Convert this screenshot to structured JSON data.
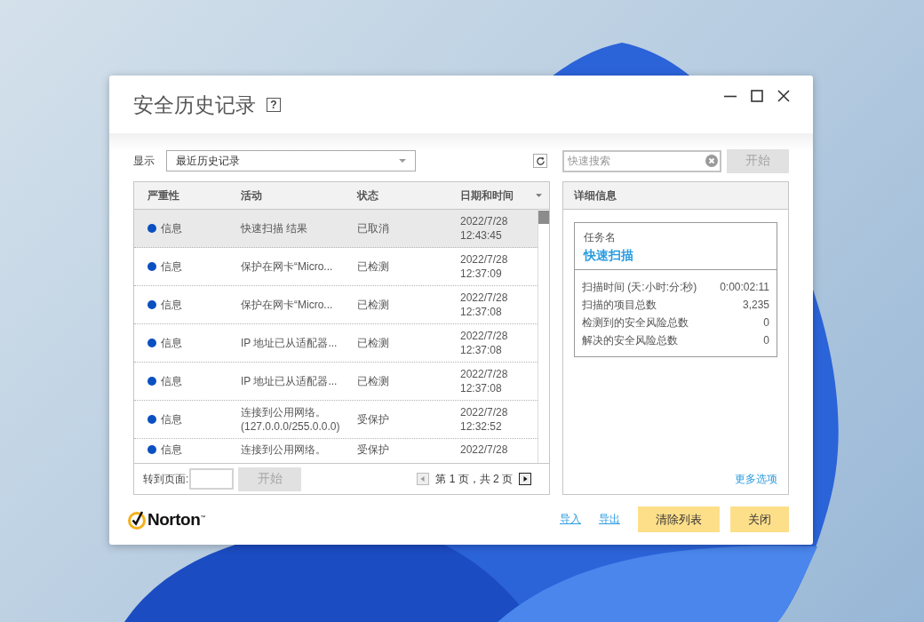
{
  "window": {
    "title": "安全历史记录",
    "help": "?"
  },
  "filter": {
    "label": "显示",
    "value": "最近历史记录"
  },
  "search": {
    "placeholder": "快速搜索",
    "button": {
      "label": "开始",
      "disabled": true
    }
  },
  "table": {
    "columns": [
      {
        "label": "严重性",
        "sorted": false
      },
      {
        "label": "活动",
        "sorted": false
      },
      {
        "label": "状态",
        "sorted": false
      },
      {
        "label": "日期和时间",
        "sorted": true
      }
    ],
    "rows": [
      {
        "severity": "信息",
        "color": "#0b50c0",
        "activity": [
          "快速扫描 结果"
        ],
        "status": "已取消",
        "date": "2022/7/28",
        "time": "12:43:45",
        "selected": true
      },
      {
        "severity": "信息",
        "color": "#0b50c0",
        "activity": [
          "保护在网卡“Micro..."
        ],
        "status": "已检测",
        "date": "2022/7/28",
        "time": "12:37:09",
        "selected": false
      },
      {
        "severity": "信息",
        "color": "#0b50c0",
        "activity": [
          "保护在网卡“Micro..."
        ],
        "status": "已检测",
        "date": "2022/7/28",
        "time": "12:37:08",
        "selected": false
      },
      {
        "severity": "信息",
        "color": "#0b50c0",
        "activity": [
          "IP 地址已从适配器..."
        ],
        "status": "已检测",
        "date": "2022/7/28",
        "time": "12:37:08",
        "selected": false
      },
      {
        "severity": "信息",
        "color": "#0b50c0",
        "activity": [
          "IP 地址已从适配器..."
        ],
        "status": "已检测",
        "date": "2022/7/28",
        "time": "12:37:08",
        "selected": false
      },
      {
        "severity": "信息",
        "color": "#0b50c0",
        "activity": [
          "连接到公用网络。",
          "(127.0.0.0/255.0.0.0)"
        ],
        "status": "受保护",
        "date": "2022/7/28",
        "time": "12:32:52",
        "selected": false
      },
      {
        "severity": "信息",
        "color": "#0b50c0",
        "activity": [
          "连接到公用网络。"
        ],
        "status": "受保护",
        "date": "2022/7/28",
        "selected": false
      }
    ],
    "pagination": {
      "label": "转到页面:",
      "button": {
        "label": "开始",
        "disabled": true
      },
      "page_text": "第 1 页，共 2 页",
      "prev_disabled": true,
      "next_disabled": false
    }
  },
  "details": {
    "title": "详细信息",
    "task_label": "任务名",
    "task_name": "快速扫描",
    "stats": [
      {
        "label": "扫描时间 (天:小时:分:秒)",
        "value": "0:00:02:11"
      },
      {
        "label": "扫描的项目总数",
        "value": "3,235"
      },
      {
        "label": "检测到的安全风险总数",
        "value": "0"
      },
      {
        "label": "解决的安全风险总数",
        "value": "0"
      }
    ],
    "more": "更多选项"
  },
  "footer": {
    "logo": "Norton$^{™}$",
    "links": [
      "导入",
      "导出"
    ],
    "buttons": [
      "清除列表",
      "关闭"
    ]
  }
}
